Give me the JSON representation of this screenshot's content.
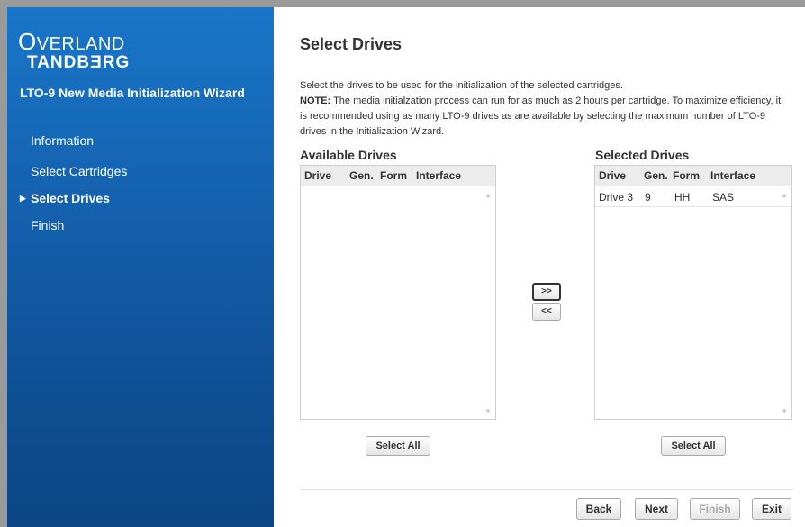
{
  "sidebar": {
    "logo_line1_cap": "O",
    "logo_line1_rest": "VERLAND",
    "logo_line2": "TANDBƎRG",
    "wizard_title": "LTO-9 New Media Initialization Wizard",
    "items": [
      {
        "label": "Information",
        "active": false
      },
      {
        "label": "Select Cartridges",
        "active": false
      },
      {
        "label": "Select Drives",
        "active": true
      },
      {
        "label": "Finish",
        "active": false
      }
    ],
    "active_marker": "▶"
  },
  "main": {
    "title": "Select Drives",
    "desc_line1": "Select the drives to be used for the initialization of the selected cartridges.",
    "note_label": "NOTE:",
    "note_text": " The media initialzation process can run for as much as 2 hours per cartridge. To maximize efficiency, it is recommended using as many LTO-9 drives as are available by selecting the maximum number of LTO-9 drives in the Initialization Wizard."
  },
  "available": {
    "title": "Available Drives",
    "columns": [
      "Drive",
      "Gen.",
      "Form",
      "Interface"
    ],
    "rows": [],
    "select_all": "Select All"
  },
  "selected": {
    "title": "Selected Drives",
    "columns": [
      "Drive",
      "Gen.",
      "Form",
      "Interface"
    ],
    "rows": [
      {
        "drive": "Drive 3",
        "gen": "9",
        "form": "HH",
        "interface": "SAS"
      }
    ],
    "select_all": "Select All"
  },
  "transfer": {
    "add": ">>",
    "remove": "<<"
  },
  "footer": {
    "back": "Back",
    "next": "Next",
    "finish": "Finish",
    "exit": "Exit"
  },
  "scroll_up_glyph": "▲",
  "scroll_down_glyph": "▼"
}
